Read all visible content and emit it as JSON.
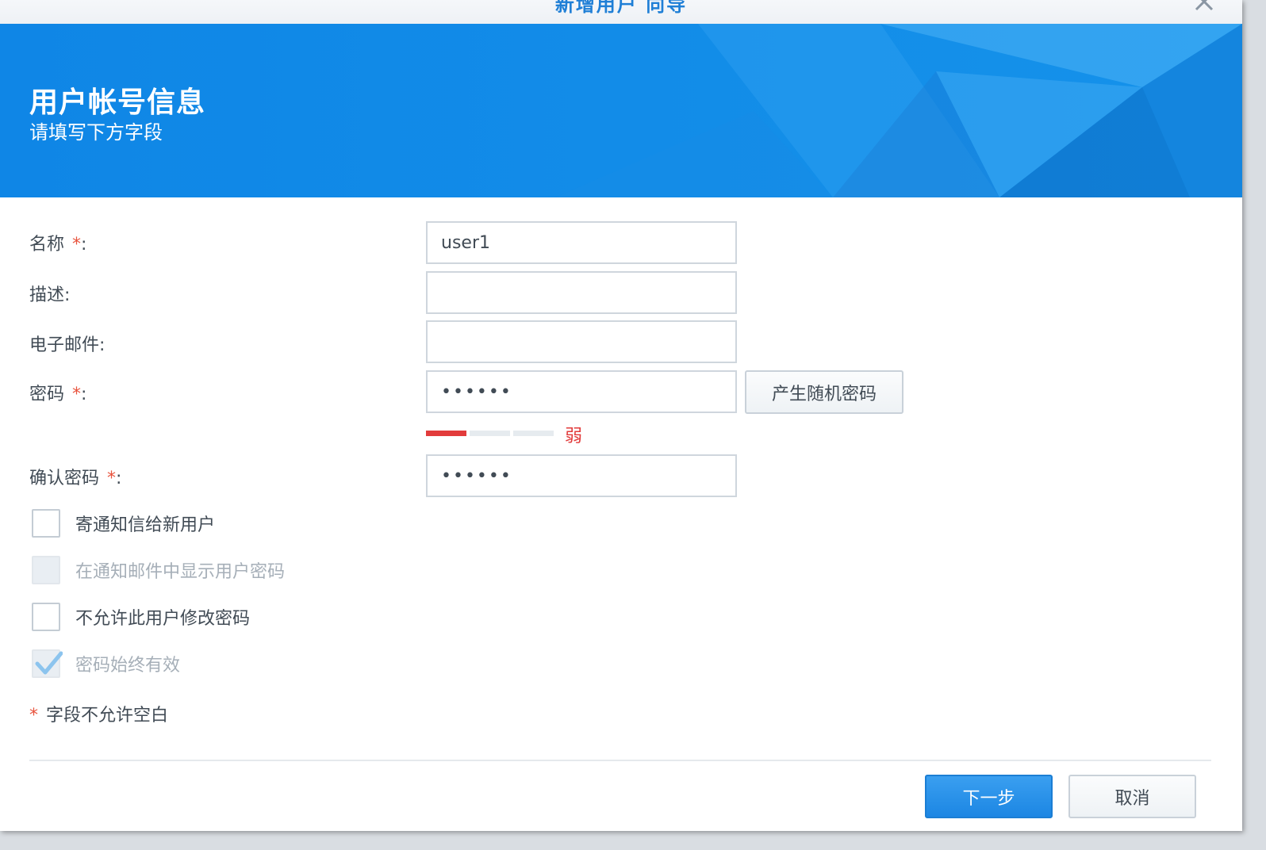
{
  "window": {
    "title": "新增用户 向导"
  },
  "banner": {
    "title": "用户帐号信息",
    "subtitle": "请填写下方字段"
  },
  "form": {
    "required_mark": "*",
    "name": {
      "label": "名称",
      "value": "user1"
    },
    "description": {
      "label": "描述:",
      "value": ""
    },
    "email": {
      "label": "电子邮件:",
      "value": ""
    },
    "password": {
      "label": "密码",
      "value": "••••••"
    },
    "confirm_password": {
      "label": "确认密码",
      "value": "••••••"
    },
    "colon": ":",
    "generate_button": "产生随机密码",
    "strength": {
      "label": "弱",
      "level": 1,
      "max": 3,
      "color": "#e23b3b"
    }
  },
  "options": [
    {
      "label": "寄通知信给新用户",
      "checked": false,
      "disabled": false
    },
    {
      "label": "在通知邮件中显示用户密码",
      "checked": false,
      "disabled": true
    },
    {
      "label": "不允许此用户修改密码",
      "checked": false,
      "disabled": false
    },
    {
      "label": "密码始终有效",
      "checked": true,
      "disabled": true
    }
  ],
  "required_note": {
    "star": "*",
    "text": "字段不允许空白"
  },
  "buttons": {
    "next": "下一步",
    "cancel": "取消"
  },
  "colors": {
    "accent": "#1a8ce8",
    "required": "#e8533d",
    "weak": "#e23b3b"
  },
  "icons": {
    "close": "close-icon",
    "check": "checkmark-icon"
  }
}
